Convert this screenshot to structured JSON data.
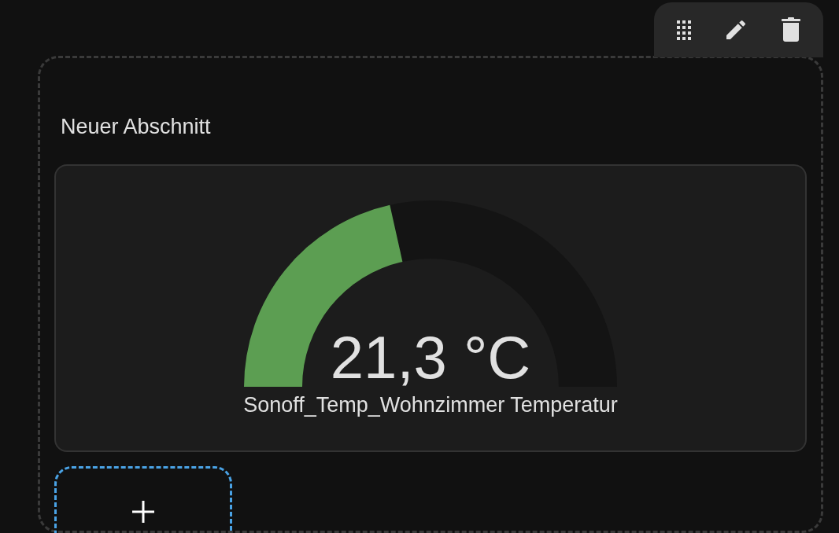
{
  "toolbar": {
    "buttons": [
      {
        "kind": "move"
      },
      {
        "kind": "edit"
      },
      {
        "kind": "delete"
      }
    ]
  },
  "section": {
    "title": "Neuer Abschnitt",
    "cards": [
      {
        "kind": "gauge",
        "value": "21,3 °C",
        "name": "Sonoff_Temp_Wohnzimmer Temperatur"
      }
    ]
  }
}
